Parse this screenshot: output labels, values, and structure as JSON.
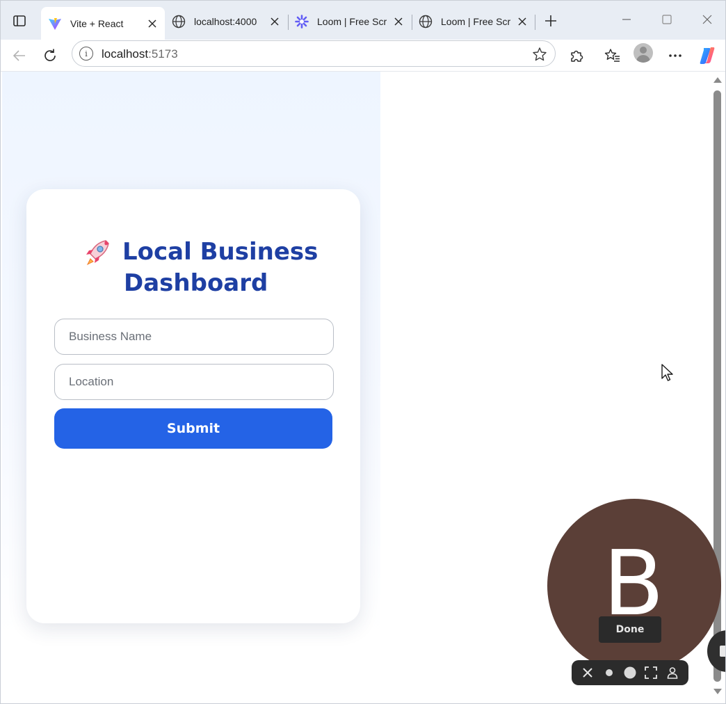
{
  "browser": {
    "tabs": [
      {
        "title": "Vite + React",
        "icon": "vite-logo-icon",
        "active": true
      },
      {
        "title": "localhost:4000",
        "icon": "globe-icon",
        "active": false
      },
      {
        "title": "Loom | Free Scr",
        "icon": "loom-logo-icon",
        "active": false
      },
      {
        "title": "Loom | Free Scr",
        "icon": "globe-icon",
        "active": false
      }
    ],
    "address": {
      "host": "localhost",
      "port": ":5173"
    },
    "toolbar_icons": [
      "back-arrow-icon",
      "refresh-icon",
      "info-icon",
      "favorite-star-icon",
      "extensions-puzzle-icon",
      "favorites-list-icon",
      "profile-avatar-icon",
      "more-ellipsis-icon",
      "copilot-icon"
    ]
  },
  "page": {
    "title_line1": "Local Business",
    "title_line2": "Dashboard",
    "title_emoji": "rocket-icon",
    "business_name_placeholder": "Business Name",
    "location_placeholder": "Location",
    "submit_label": "Submit",
    "colors": {
      "title": "#1e3fa3",
      "button": "#2463e6",
      "panel": "#eef5ff"
    }
  },
  "loom": {
    "camera_initial": "B",
    "done_label": "Done",
    "controls": [
      "close-icon",
      "dot-small-icon",
      "dot-large-icon",
      "fullscreen-icon",
      "person-icon"
    ]
  }
}
